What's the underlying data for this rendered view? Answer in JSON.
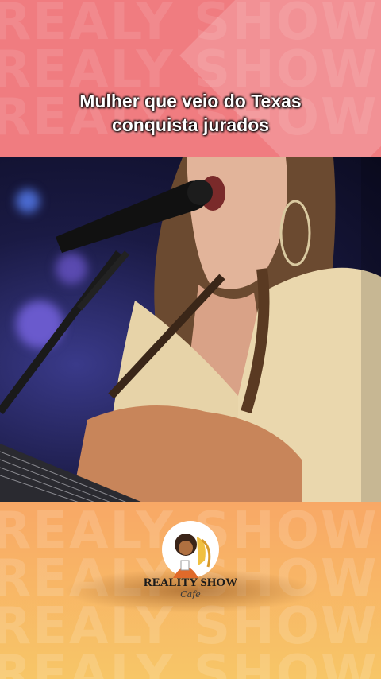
{
  "headline": {
    "line1": "Mulher que veio do Texas",
    "line2": "conquista jurados"
  },
  "watermark": {
    "text": "REALY SHOW REALY SHOW"
  },
  "logo": {
    "brand": "REALITY SHOW",
    "sub": "Cafe"
  },
  "colors": {
    "top_band": "#f07c80",
    "bottom_band": "#f7c667",
    "headline_text": "#ffffff"
  }
}
